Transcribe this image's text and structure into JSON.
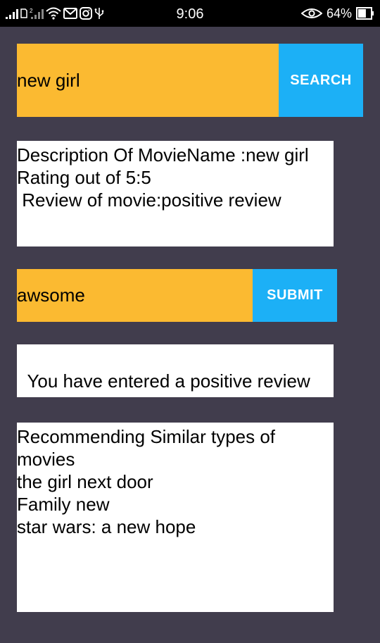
{
  "status_bar": {
    "time": "9:06",
    "battery_percent": "64%",
    "icons": [
      "signal-icon",
      "sim-icon",
      "signal-2-icon",
      "wifi-icon",
      "gmail-icon",
      "instagram-icon",
      "usb-icon",
      "eye-icon",
      "battery-icon"
    ],
    "battery_level": 0.64
  },
  "search": {
    "value": "new girl",
    "button_label": "SEARCH"
  },
  "description": {
    "line1": "Description Of MovieName :new girl",
    "line2": "Rating out of 5:5",
    "line3": " Review of movie:positive review"
  },
  "review": {
    "value": "awsome",
    "button_label": "SUBMIT"
  },
  "result": {
    "text": "You have entered a positive review"
  },
  "recommendations": {
    "heading_line1": "Recommending Similar types of",
    "heading_line2": "movies",
    "items": [
      "the girl next door",
      "Family new",
      "star wars: a new hope"
    ]
  },
  "colors": {
    "background": "#413d4d",
    "input_bg": "#fbba31",
    "button_bg": "#1cb0f6",
    "status_bar": "#000000"
  }
}
